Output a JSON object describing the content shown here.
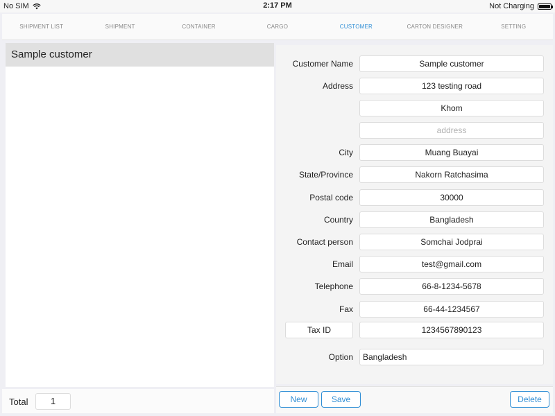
{
  "status_bar": {
    "carrier": "No SIM",
    "time": "2:17 PM",
    "battery_text": "Not Charging",
    "wifi_icon": "wifi-icon",
    "battery_icon": "battery-icon"
  },
  "tabs": [
    {
      "label": "SHIPMENT LIST",
      "active": false
    },
    {
      "label": "SHIPMENT",
      "active": false
    },
    {
      "label": "CONTAINER",
      "active": false
    },
    {
      "label": "CARGO",
      "active": false
    },
    {
      "label": "CUSTOMER",
      "active": true
    },
    {
      "label": "CARTON DESIGNER",
      "active": false
    },
    {
      "label": "SETTING",
      "active": false
    }
  ],
  "customer_list": {
    "items": [
      "Sample customer"
    ],
    "total_label": "Total",
    "total_value": "1"
  },
  "form": {
    "customer_name_label": "Customer Name",
    "customer_name": "Sample customer",
    "address_label": "Address",
    "address_line1": "123 testing road",
    "address_line2": "Khom",
    "address_line3_placeholder": "address",
    "city_label": "City",
    "city": "Muang Buayai",
    "state_label": "State/Province",
    "state": "Nakorn Ratchasima",
    "postal_label": "Postal code",
    "postal": "30000",
    "country_label": "Country",
    "country": "Bangladesh",
    "contact_label": "Contact person",
    "contact": "Somchai Jodprai",
    "email_label": "Email",
    "email": "test@gmail.com",
    "telephone_label": "Telephone",
    "telephone": "66-8-1234-5678",
    "fax_label": "Fax",
    "fax": "66-44-1234567",
    "tax_id_label": "Tax ID",
    "tax_id": "1234567890123",
    "option_label": "Option",
    "option": "Bangladesh"
  },
  "actions": {
    "new_label": "New",
    "save_label": "Save",
    "delete_label": "Delete"
  },
  "colors": {
    "accent": "#2f8ed5",
    "selected_row": "#e0e0e0"
  }
}
